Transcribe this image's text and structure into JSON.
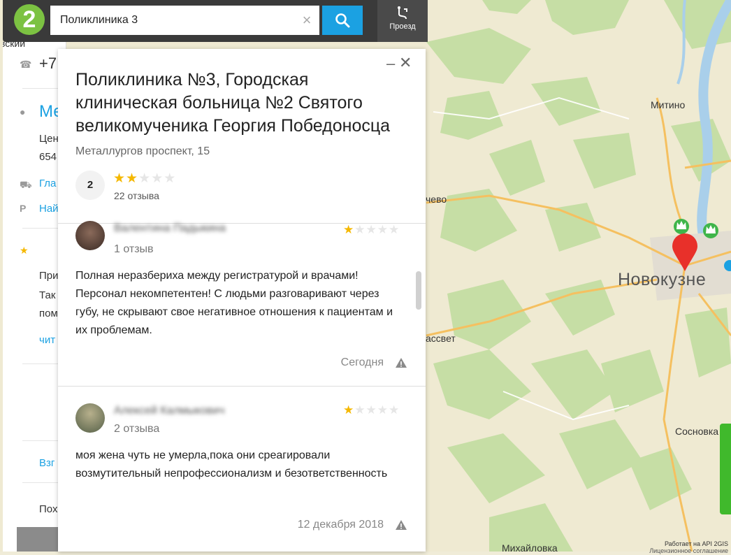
{
  "search": {
    "value": "Поликлиника 3"
  },
  "route_button": {
    "label": "Проезд"
  },
  "logo": {
    "text": "2"
  },
  "left_panel": {
    "phone": "+7",
    "title": "Ме",
    "address1": "Цен",
    "address2": "654",
    "link1": "Гла",
    "link2": "Най",
    "text1": "При",
    "text2": "Так",
    "text3": "пом",
    "more": "чит",
    "reply": "Взг",
    "similar": "Пох",
    "partial_top": "вский"
  },
  "popup": {
    "title": "Поликлиника №3, Городская клиническая больница №2 Святого великомученика Георгия Победоносца",
    "address": "Металлургов проспект, 15",
    "rating": "2",
    "stars_filled": 2,
    "stars_total": 5,
    "reviews_count": "22 отзыва",
    "minimize_label": "–",
    "close_label": "✕"
  },
  "reviews": [
    {
      "author": "Валентина Падыкина",
      "count": "1 отзыв",
      "stars_filled": 1,
      "text": "Полная неразбериха между регистратурой и врачами! Персонал некомпетентен! С людьми разговаривают через губу, не скрывают свое негативное отношения к пациентам и их проблемам.",
      "date": "Сегодня"
    },
    {
      "author": "Алексей Калмыкович",
      "count": "2 отзыва",
      "stars_filled": 1,
      "text": "моя жена чуть не умерла,пока они среагировали возмутительный непрофессионализм и безответственность",
      "date": "12 декабря 2018"
    }
  ],
  "map": {
    "city": "Новокузне",
    "places": [
      "Митино",
      "чево",
      "ассвет",
      "Сосновка",
      "Михайловка"
    ],
    "credit": "Работает на API 2GIS",
    "credit2": "Лицензионное соглашение"
  },
  "colors": {
    "accent": "#1ba1e2",
    "brand": "#7cc242",
    "star": "#f5b800",
    "marker": "#e8302a"
  }
}
